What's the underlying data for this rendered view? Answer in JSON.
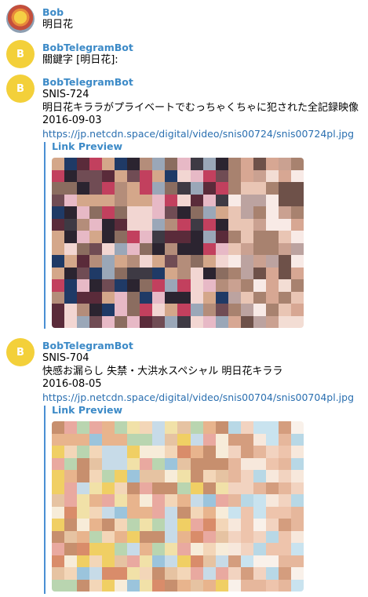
{
  "messages": [
    {
      "sender": "Bob",
      "lines": [
        "明日花"
      ]
    },
    {
      "sender": "BobTelegramBot",
      "avatar_letter": "B",
      "lines": [
        "關鍵字 [明日花]:"
      ]
    },
    {
      "sender": "BobTelegramBot",
      "avatar_letter": "B",
      "lines": [
        "SNIS-724",
        "明日花キララがプライベートでむっちゃくちゃに犯された全記録映像",
        "2016-09-03"
      ],
      "link": "https://jp.netcdn.space/digital/video/snis00724/snis00724pl.jpg",
      "preview_label": "Link Preview"
    },
    {
      "sender": "BobTelegramBot",
      "avatar_letter": "B",
      "lines": [
        "SNIS-704",
        "快感お漏らし 失禁・大洪水スペシャル 明日花キララ",
        "2016-08-05"
      ],
      "link": "https://jp.netcdn.space/digital/video/snis00704/snis00704pl.jpg",
      "preview_label": "Link Preview"
    }
  ],
  "colors": {
    "sender": "#3c8ac7",
    "link": "#2a6fb0",
    "bot_avatar": "#f3d03a",
    "preview_bar": "#4a8fd3"
  }
}
